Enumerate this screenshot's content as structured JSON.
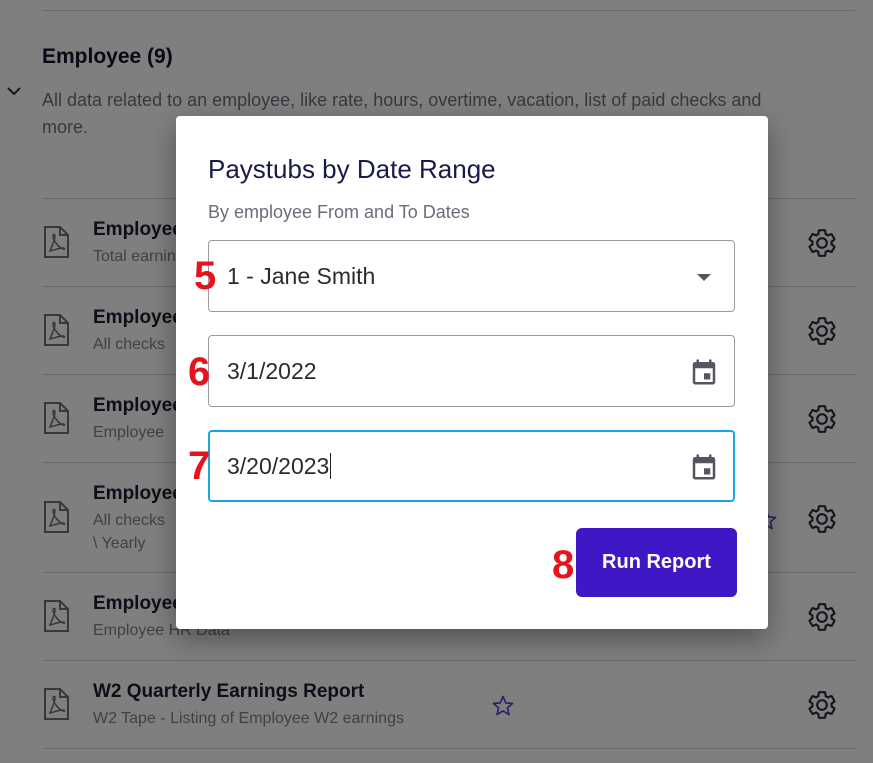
{
  "section": {
    "title": "Employee (9)",
    "description": "All data related to an employee, like rate, hours, overtime, vacation, list of paid checks and more."
  },
  "reports": [
    {
      "title": "Employee Earnings",
      "subtitle": "Total earnings"
    },
    {
      "title": "Employee Checks",
      "subtitle": "All checks"
    },
    {
      "title": "Employee Details",
      "subtitle": "Employee"
    },
    {
      "title": "Employee Checks Summary",
      "subtitle": "All checks",
      "subtitle2": "\\ Yearly"
    },
    {
      "title": "Employee HR",
      "subtitle": "Employee HR Data"
    },
    {
      "title": "W2 Quarterly Earnings Report",
      "subtitle": "W2 Tape - Listing of Employee W2 earnings"
    }
  ],
  "dialog": {
    "title": "Paystubs by Date Range",
    "subtitle": "By employee From and To Dates",
    "employee_select": {
      "value": "1 - Jane Smith"
    },
    "from_date": {
      "value": "3/1/2022"
    },
    "to_date": {
      "value": "3/20/2023"
    },
    "run_button": "Run Report"
  },
  "annotations": [
    "5",
    "6",
    "7",
    "8"
  ],
  "icons": {
    "pdf": "pdf-file-icon",
    "gear": "gear-icon",
    "star": "star-icon",
    "calendar": "calendar-icon",
    "dropdown": "dropdown-arrow-icon",
    "chevron": "chevron-down-icon"
  },
  "colors": {
    "accent": "#3f17c4",
    "focus": "#1ba3e6",
    "annotation": "#e8121b",
    "overlay": "rgba(0,0,0,0.5)"
  }
}
